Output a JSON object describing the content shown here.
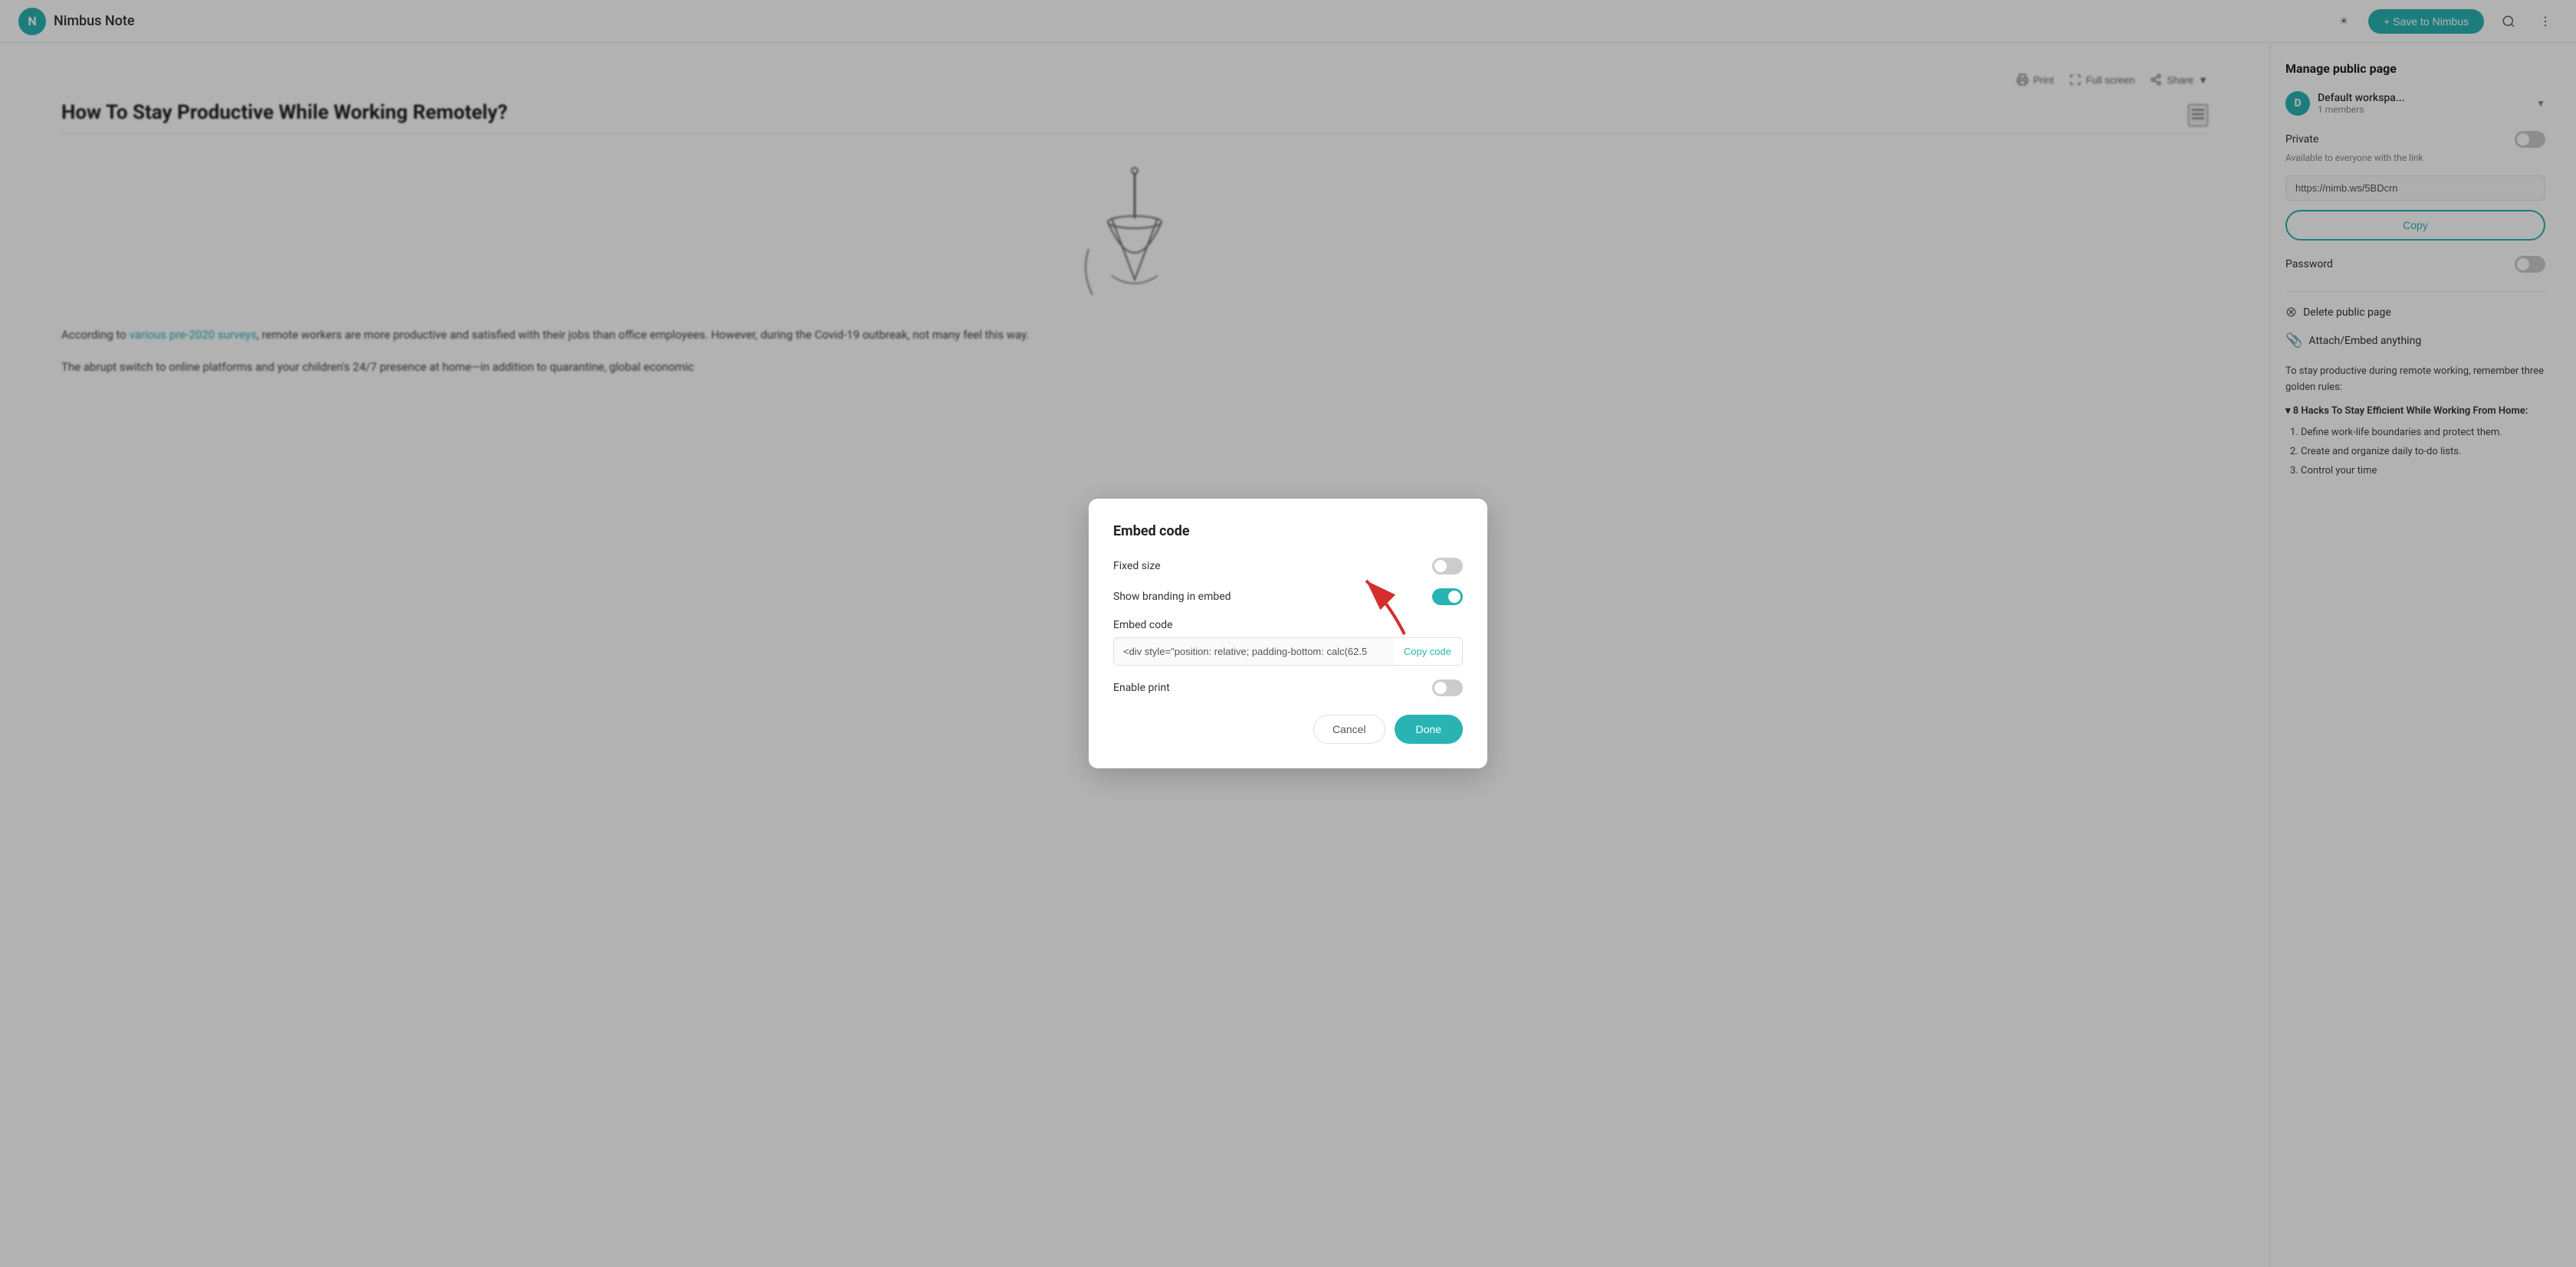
{
  "header": {
    "logo_letter": "N",
    "app_name": "Nimbus Note",
    "save_label": "+ Save to Nimbus"
  },
  "toolbar": {
    "print_label": "Print",
    "fullscreen_label": "Full screen",
    "share_label": "Share"
  },
  "article": {
    "title": "How To Stay Productive While Working Remotely?",
    "body_para1": "According to various pre-2020 surveys, remote workers are more productive and satisfied with their jobs than office employees. However, during the Covid-19 outbreak, not many feel this way.",
    "body_para2": "The abrupt switch to online platforms and your children's 24/7 presence at home—in addition to quarantine, global economic",
    "link_text": "various pre-2020 surveys"
  },
  "modal": {
    "title": "Embed code",
    "fixed_size_label": "Fixed size",
    "show_branding_label": "Show branding in embed",
    "embed_code_label": "Embed code",
    "embed_code_value": "<div style=\"position: relative; padding-bottom: calc(62.5",
    "copy_code_label": "Copy code",
    "enable_print_label": "Enable print",
    "cancel_label": "Cancel",
    "done_label": "Done"
  },
  "sidebar": {
    "title": "Manage public page",
    "workspace": {
      "avatar_letter": "D",
      "name": "Default workspa...",
      "members": "1 members"
    },
    "private_label": "Private",
    "private_sub": "Available to everyone with the link",
    "url_value": "https://nimb.ws/5BDcrn",
    "copy_label": "Copy",
    "password_label": "Password",
    "delete_label": "Delete public page",
    "attach_label": "Attach/Embed anything",
    "notes": {
      "intro": "To stay productive during remote working, remember three golden rules:",
      "section_heading": "8 Hacks To Stay Efficient While Working From Home:",
      "items": [
        "Define work-life boundaries and protect them.",
        "Create and organize daily to-do lists.",
        "Control your time"
      ]
    }
  }
}
